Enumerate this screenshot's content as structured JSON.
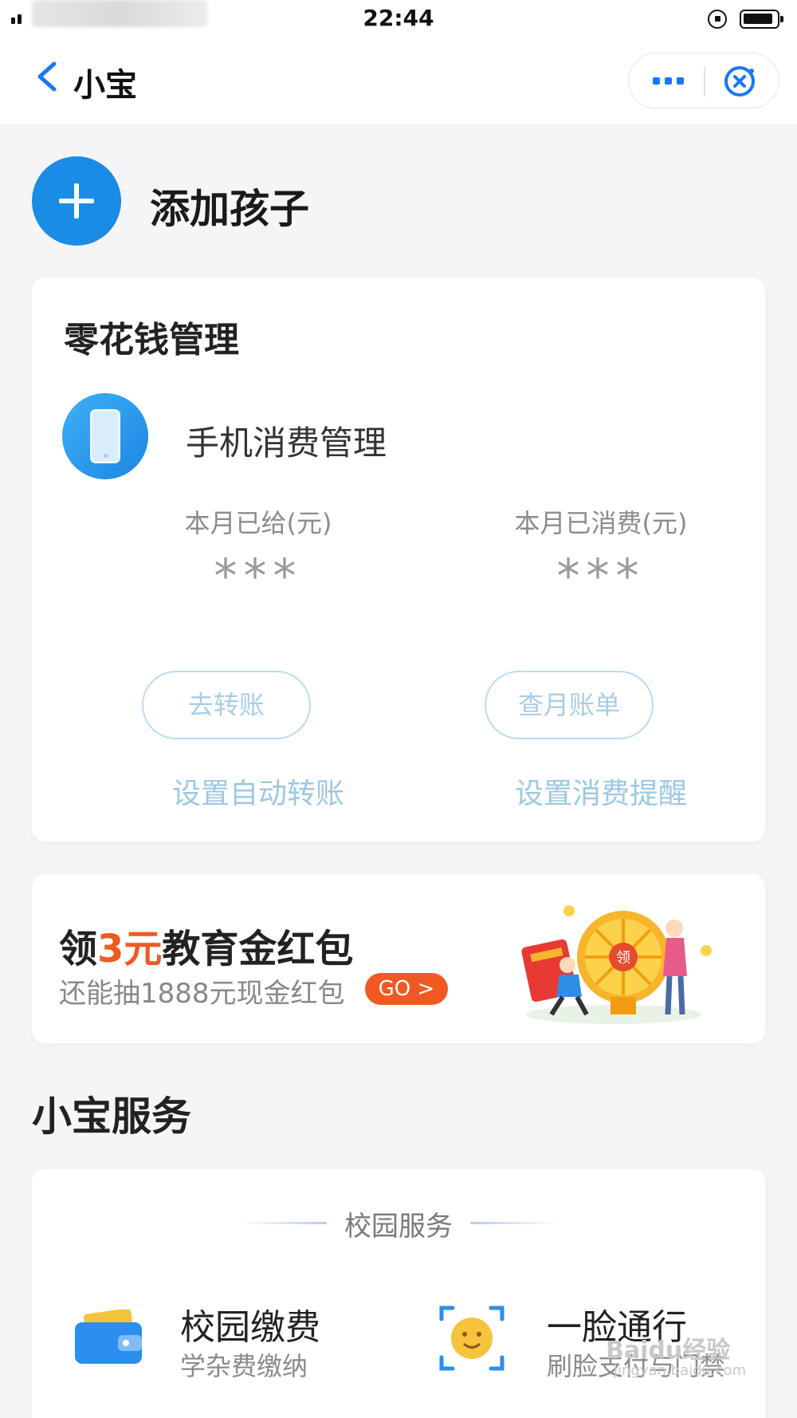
{
  "status_bar": {
    "time": "22:44"
  },
  "nav": {
    "title": "小宝"
  },
  "add_child": {
    "label": "添加孩子"
  },
  "allowance": {
    "title": "零花钱管理",
    "item_label": "手机消费管理",
    "given_label": "本月已给(元)",
    "given_value": "***",
    "spent_label": "本月已消费(元)",
    "spent_value": "***",
    "transfer_button": "去转账",
    "bill_button": "查月账单",
    "auto_transfer_link": "设置自动转账",
    "spend_alert_link": "设置消费提醒"
  },
  "promo": {
    "title_prefix": "领",
    "title_amount": "3元",
    "title_suffix": "教育金红包",
    "subtitle": "还能抽1888元现金红包",
    "go_label": "GO >",
    "art_badge": "领"
  },
  "services": {
    "section_title": "小宝服务",
    "group_title": "校园服务",
    "items": [
      {
        "name": "校园缴费",
        "desc": "学杂费缴纳",
        "icon": "wallet-icon"
      },
      {
        "name": "一脸通行",
        "desc": "刷脸支付与门禁",
        "icon": "face-scan-icon"
      }
    ]
  },
  "watermark": {
    "line1": "Baidu经验",
    "line2": "jingyan.baidu.com"
  },
  "colors": {
    "accent": "#1b8ce6",
    "promo": "#f05a22"
  }
}
